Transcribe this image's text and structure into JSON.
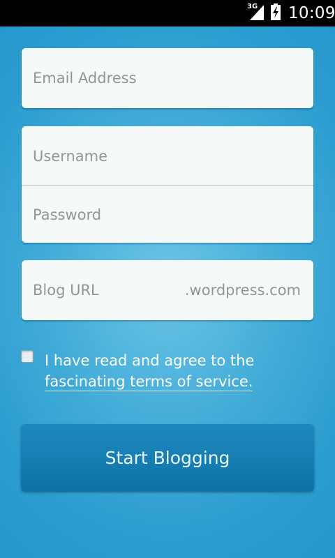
{
  "status_bar": {
    "network": "3G",
    "time": "10:09"
  },
  "signup_form": {
    "email_placeholder": "Email Address",
    "username_placeholder": "Username",
    "password_placeholder": "Password",
    "blog_url_placeholder": "Blog URL",
    "blog_url_suffix": ".wordpress.com"
  },
  "terms": {
    "prefix": "I have read and agree to the",
    "link_text": "fascinating terms of service",
    "suffix": "."
  },
  "start_button_label": "Start Blogging",
  "colors": {
    "background": "#2b9ccf",
    "field_background": "#f5f9f8",
    "button": "#167eb2",
    "status_bar": "#000000"
  }
}
